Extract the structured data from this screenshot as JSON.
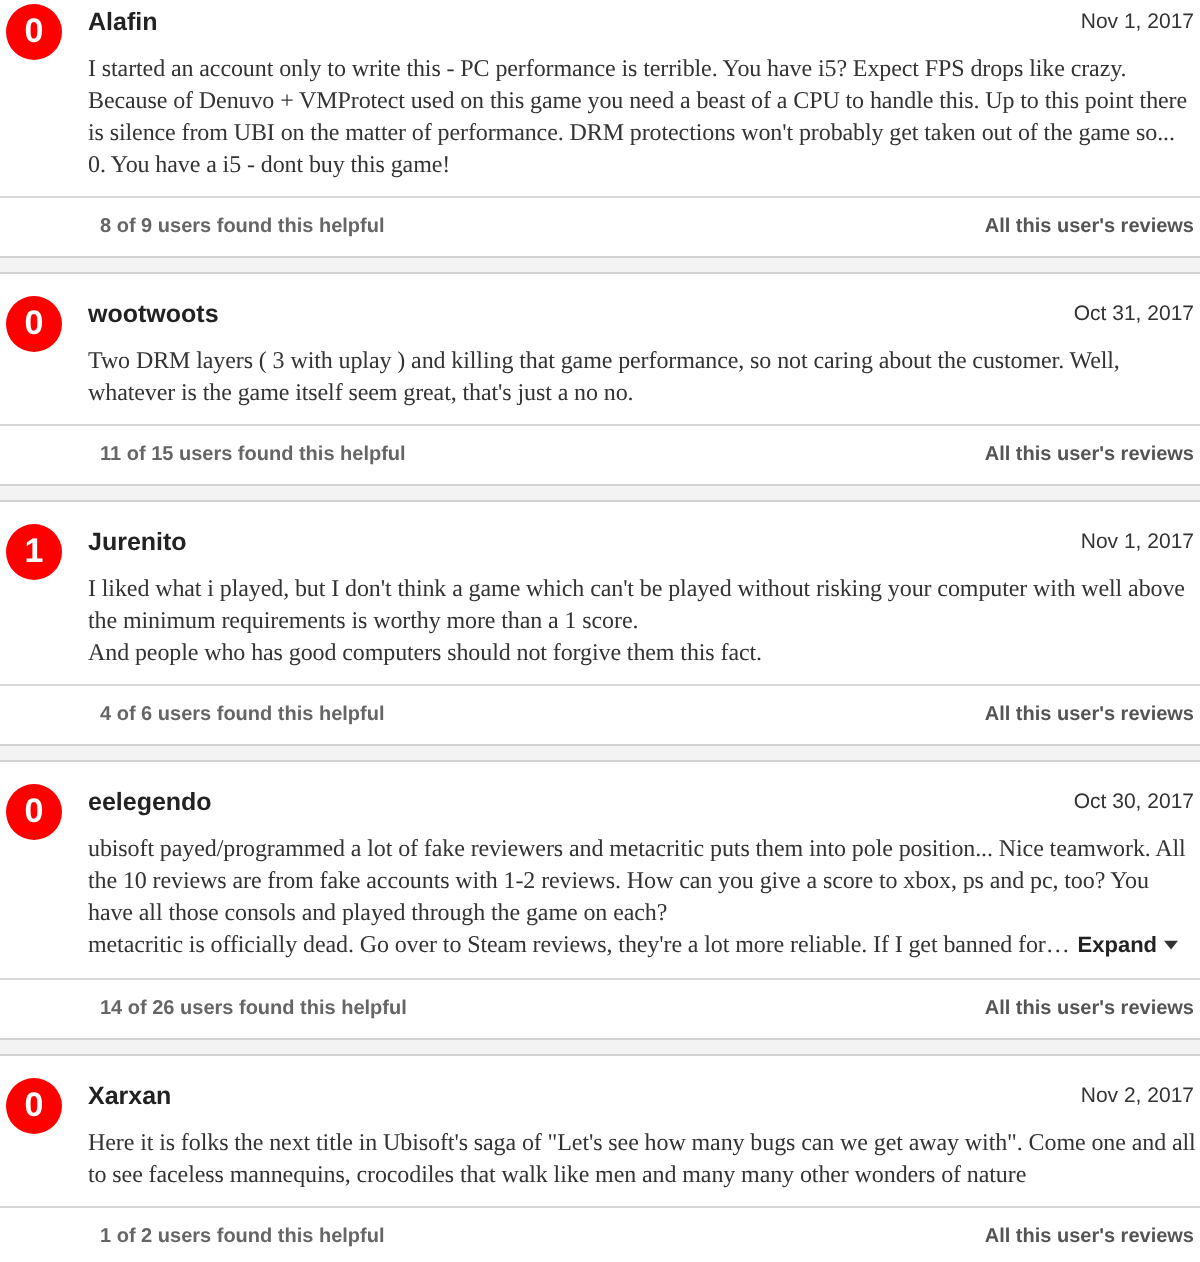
{
  "reviews": [
    {
      "score": "0",
      "username": "Alafin",
      "date": "Nov 1, 2017",
      "body": "I started an account only to write this - PC performance is terrible. You have i5? Expect FPS drops like crazy. Because of Denuvo + VMProtect used on this game you need a beast of a CPU to handle this. Up to this point there is silence from UBI on the matter of performance. DRM protections won't probably get taken out of the game so... 0. You have a i5 - dont buy this game!",
      "helpful": "8 of 9 users found this helpful",
      "all_reviews": "All this user's reviews"
    },
    {
      "score": "0",
      "username": "wootwoots",
      "date": "Oct 31, 2017",
      "body": "Two DRM layers ( 3 with uplay ) and killing that game performance, so not caring about the customer. Well, whatever is the game itself seem great, that's just a no no.",
      "helpful": "11 of 15 users found this helpful",
      "all_reviews": "All this user's reviews"
    },
    {
      "score": "1",
      "username": "Jurenito",
      "date": "Nov 1, 2017",
      "body": "I liked what i played, but I don't think a game which can't be played without risking your computer with well above the minimum requirements is worthy more than a 1 score.\nAnd people who has good computers should not forgive them this fact.",
      "helpful": "4 of 6 users found this helpful",
      "all_reviews": "All this user's reviews"
    },
    {
      "score": "0",
      "username": "eelegendo",
      "date": "Oct 30, 2017",
      "body": "ubisoft payed/programmed a lot of fake reviewers and metacritic puts them into pole position... Nice teamwork. All the 10 reviews are from fake accounts with 1-2 reviews. How can you give a score to xbox, ps and pc, too? You have all those consols and played through the game on each?\nmetacritic is officially dead. Go over to Steam reviews, they're a lot more reliable. If I get banned for…",
      "expand": "Expand",
      "helpful": "14 of 26 users found this helpful",
      "all_reviews": "All this user's reviews"
    },
    {
      "score": "0",
      "username": "Xarxan",
      "date": "Nov 2, 2017",
      "body": "Here it is folks the next title in Ubisoft's saga of \"Let's see how many bugs can we get away with\". Come one and all to see faceless mannequins, crocodiles that walk like men and many many other wonders of nature",
      "helpful": "1 of 2 users found this helpful",
      "all_reviews": "All this user's reviews"
    }
  ]
}
